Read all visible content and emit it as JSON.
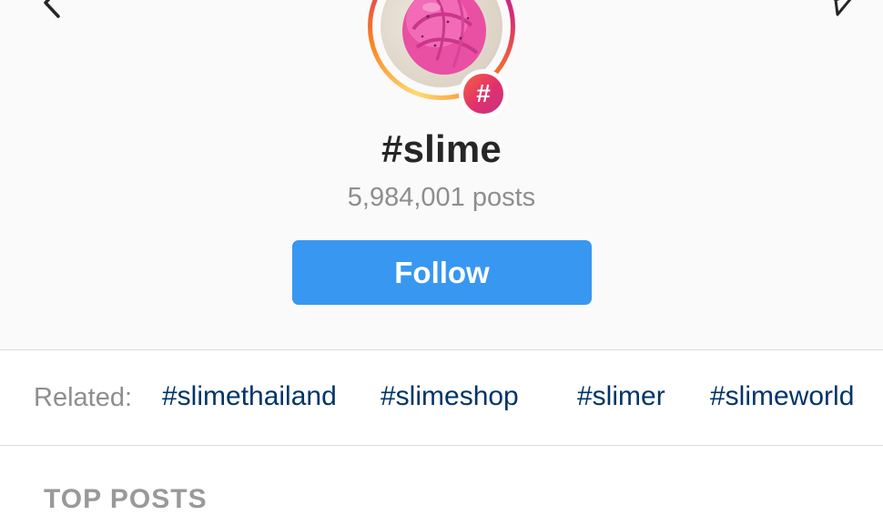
{
  "hashtag": {
    "title": "#slime",
    "post_count": "5,984,001 posts",
    "badge_symbol": "#"
  },
  "actions": {
    "follow_label": "Follow"
  },
  "related": {
    "label": "Related:",
    "tags": [
      "#slimethailand",
      "#slimeshop",
      "#slimer",
      "#slimeworld"
    ]
  },
  "sections": {
    "top_posts_heading": "TOP POSTS"
  },
  "icons": {
    "back": "chevron-left-icon",
    "share": "paper-plane-icon"
  },
  "colors": {
    "follow_button": "#3897f0",
    "related_tag": "#003569",
    "muted_text": "#8e8e8e",
    "slime_pink": "#ec4fa6"
  }
}
